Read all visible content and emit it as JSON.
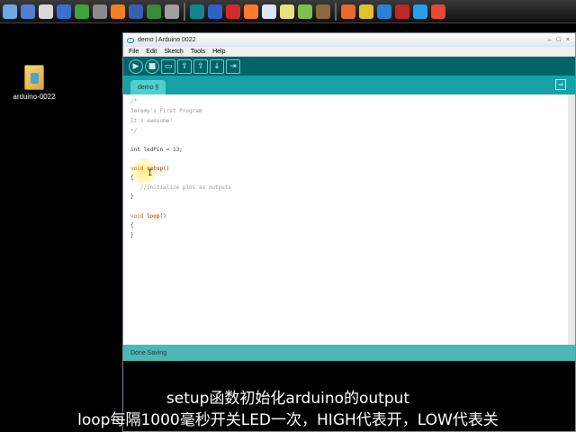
{
  "taskbar": {
    "icons": [
      {
        "name": "computer-icon",
        "color": "#6aa8e8"
      },
      {
        "name": "window-icon",
        "color": "#4f7ed2"
      },
      {
        "name": "monitor-icon",
        "color": "#d8d8d8"
      },
      {
        "name": "network-icon",
        "color": "#3a6fd0"
      },
      {
        "name": "flag-icon",
        "color": "#3fa23a"
      },
      {
        "name": "settings-icon",
        "color": "#8a8a8a"
      },
      {
        "name": "vlc-icon",
        "color": "#f08020"
      },
      {
        "name": "image-icon",
        "color": "#3b5fb0"
      },
      {
        "name": "globe-icon",
        "color": "#3a8a3a"
      },
      {
        "name": "tools-icon",
        "color": "#a0a0a0"
      },
      {
        "name": "arduino-icon",
        "color": "#12888e"
      },
      {
        "name": "p-icon",
        "color": "#2d63c9"
      },
      {
        "name": "red-arrow-icon",
        "color": "#d42a2a"
      },
      {
        "name": "dash-icon",
        "color": "#ff7a2b"
      },
      {
        "name": "envelope-icon",
        "color": "#d7e7f7"
      },
      {
        "name": "network-tool-icon",
        "color": "#e8e07a"
      },
      {
        "name": "puzzle-icon",
        "color": "#7fc04a"
      },
      {
        "name": "cube-icon",
        "color": "#8c6a3a"
      },
      {
        "name": "firefox-icon",
        "color": "#e86a2a"
      },
      {
        "name": "chrome-icon",
        "color": "#e3c12a"
      },
      {
        "name": "ie-icon",
        "color": "#2b7fd9"
      },
      {
        "name": "filezilla-icon",
        "color": "#c22727"
      },
      {
        "name": "skype-icon",
        "color": "#27a1e3"
      },
      {
        "name": "gmail-icon",
        "color": "#e34a3a"
      }
    ]
  },
  "desktop": {
    "icon_label": "arduino-0022"
  },
  "window": {
    "title": "demo | Arduino 0022",
    "controls": [
      "–",
      "□",
      "×"
    ],
    "menus": [
      "File",
      "Edit",
      "Sketch",
      "Tools",
      "Help"
    ],
    "toolbar": [
      "▶",
      "■",
      "▭",
      "⇪",
      "⇧",
      "↓",
      "⇥"
    ],
    "tab_label": "demo §",
    "tab_menu_symbol": "⇒",
    "status": "Done Saving"
  },
  "editor": {
    "lines": [
      {
        "type": "comment",
        "text": "/*"
      },
      {
        "type": "comment",
        "text": "Jeremy's First Program"
      },
      {
        "type": "comment",
        "text": "It's awesome!"
      },
      {
        "type": "comment",
        "text": "*/"
      },
      {
        "type": "blank",
        "text": ""
      },
      {
        "type": "code",
        "text": "int ledPin = 13;"
      },
      {
        "type": "blank",
        "text": ""
      },
      {
        "type": "setup",
        "text": "void setup()"
      },
      {
        "type": "code",
        "text": "{"
      },
      {
        "type": "comment_indent",
        "text": "   //initialize pins as outputs"
      },
      {
        "type": "code",
        "text": "}"
      },
      {
        "type": "blank",
        "text": ""
      },
      {
        "type": "loop",
        "text": "void loop()"
      },
      {
        "type": "code",
        "text": "{"
      },
      {
        "type": "code",
        "text": "}"
      }
    ],
    "cursor_symbol": "I"
  },
  "subtitles": {
    "line1": "setup函数初始化arduino的output",
    "line2": "loop每隔1000毫秒开关LED一次，HIGH代表开，LOW代表关"
  },
  "colors": {
    "toolbar": "#006468",
    "tabbar": "#17a1a5",
    "status": "#4db7b5",
    "keyword": "#cc6633"
  }
}
